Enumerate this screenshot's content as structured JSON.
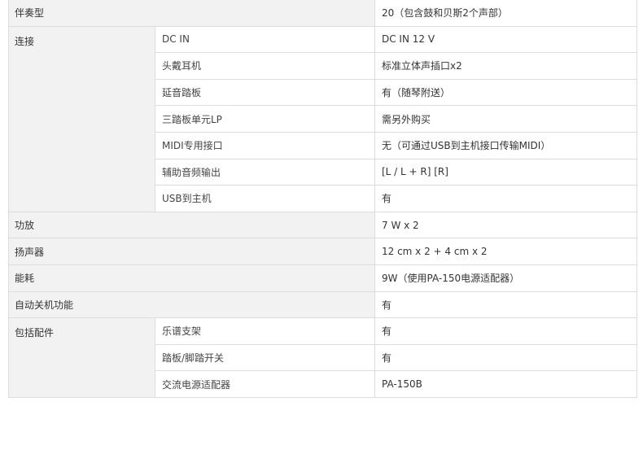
{
  "rows": {
    "accompaniment": {
      "label": "伴奏型",
      "value": "20（包含鼓和贝斯2个声部）"
    },
    "connections": {
      "label": "连接",
      "items": [
        {
          "name": "DC IN",
          "value": "DC IN 12 V"
        },
        {
          "name": "头戴耳机",
          "value": "标准立体声插口x2"
        },
        {
          "name": "延音踏板",
          "value": "有（随琴附送）"
        },
        {
          "name": "三踏板单元LP",
          "value": "需另外购买"
        },
        {
          "name": "MIDI专用接口",
          "value": "无（可通过USB到主机接口传输MIDI）"
        },
        {
          "name": "辅助音频输出",
          "value": "[L / L + R] [R]"
        },
        {
          "name": "USB到主机",
          "value": "有"
        }
      ]
    },
    "power_output": {
      "label": "功放",
      "value": "7 W x 2"
    },
    "speakers": {
      "label": "扬声器",
      "value": "12 cm x 2 + 4 cm x 2"
    },
    "consumption": {
      "label": "能耗",
      "value": "9W（使用PA-150电源适配器）"
    },
    "auto_off": {
      "label": "自动关机功能",
      "value": "有"
    },
    "accessories": {
      "label": "包括配件",
      "items": [
        {
          "name": "乐谱支架",
          "value": "有"
        },
        {
          "name": "踏板/脚踏开关",
          "value": "有"
        },
        {
          "name": "交流电源适配器",
          "value": "PA-150B"
        }
      ]
    }
  }
}
